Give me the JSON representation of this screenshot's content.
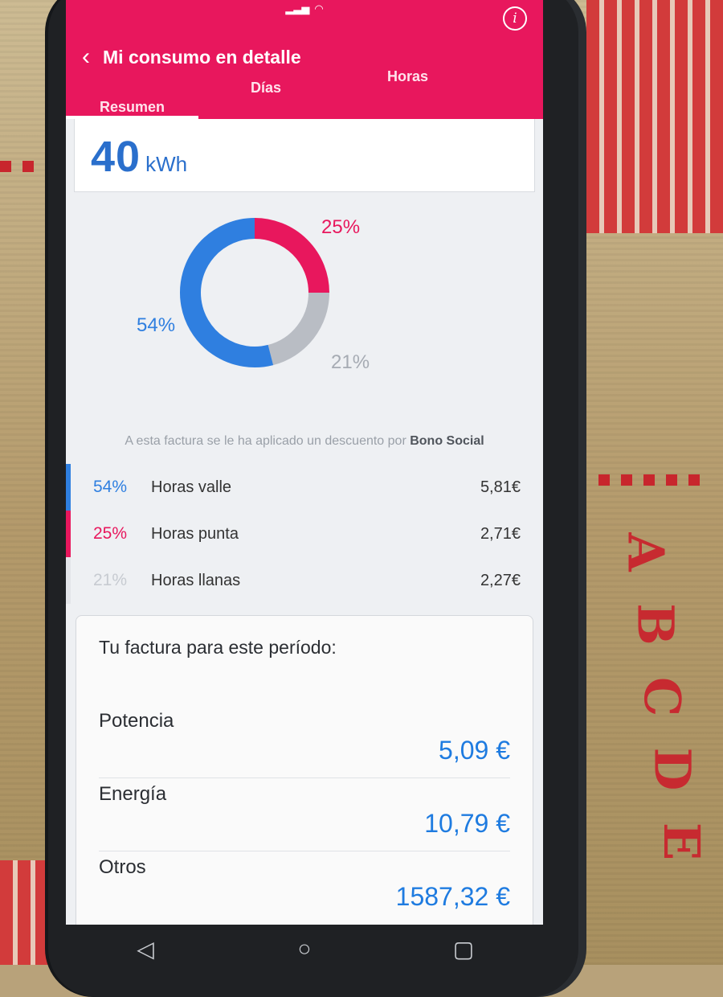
{
  "header": {
    "title": "Mi consumo en detalle",
    "tabs": [
      {
        "label": "Resumen",
        "active": true
      },
      {
        "label": "Días",
        "active": false
      },
      {
        "label": "Horas",
        "active": false
      }
    ],
    "color": "#e8175d"
  },
  "summary": {
    "value": "40",
    "unit": "kWh"
  },
  "chart_data": {
    "type": "pie",
    "categories": [
      "Horas valle",
      "Horas punta",
      "Horas llanas"
    ],
    "values": [
      54,
      25,
      21
    ],
    "labels": [
      "54%",
      "25%",
      "21%"
    ],
    "colors": [
      "#2f7fe0",
      "#e8175d",
      "#b9bdc4"
    ]
  },
  "note": {
    "text": "A esta factura se le ha aplicado un descuento por ",
    "bold": "Bono Social"
  },
  "breakdown": [
    {
      "pct": "54%",
      "label": "Horas valle",
      "value": "5,81€",
      "color": "#2f7fe0"
    },
    {
      "pct": "25%",
      "label": "Horas punta",
      "value": "2,71€",
      "color": "#e8175d"
    },
    {
      "pct": "21%",
      "label": "Horas llanas",
      "value": "2,27€",
      "color": "#c7cbd1"
    }
  ],
  "bill": {
    "title": "Tu factura para este período:",
    "items": [
      {
        "label": "Potencia",
        "value": "5,09 €"
      },
      {
        "label": "Energía",
        "value": "10,79 €"
      },
      {
        "label": "Otros",
        "value": "1587,32 €"
      }
    ],
    "value_color": "#1e7be0"
  },
  "icons": {
    "info": "info-icon",
    "back": "chevron-left-icon",
    "nav_back": "triangle-back-icon",
    "nav_home": "circle-home-icon",
    "nav_recent": "square-recent-icon"
  }
}
